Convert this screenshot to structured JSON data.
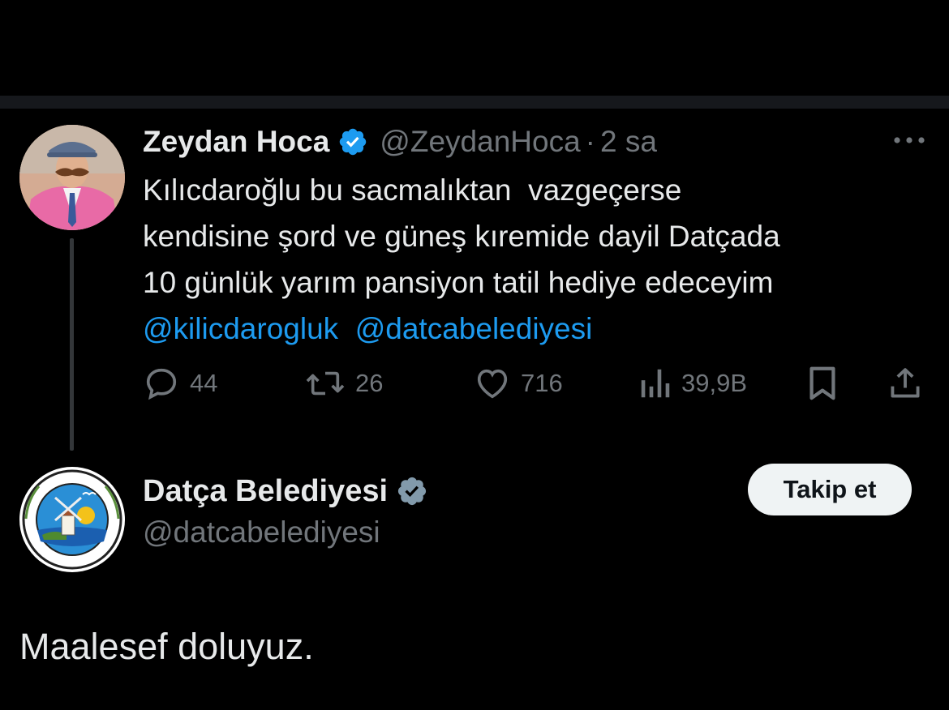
{
  "colors": {
    "background": "#000000",
    "text_primary": "#e7e9ea",
    "text_secondary": "#71767b",
    "accent_link": "#1d9bf0",
    "verified_blue": "#1d9bf0",
    "verified_gray": "#829aab",
    "follow_button_bg": "#eff3f4"
  },
  "tweet": {
    "author": {
      "display_name": "Zeydan Hoca",
      "handle": "@ZeydanHoca",
      "verified_icon": "verified-blue-badge-icon"
    },
    "separator": "·",
    "time": "2 sa",
    "more_icon": "more-horizontal-icon",
    "lines": [
      "Kılıcdaroğlu bu sacmalıktan  vazgeçerse",
      "kendisine şord ve güneş kıremide dayil Datçada",
      "10 günlük yarım pansiyon tatil hediye edeceyim"
    ],
    "mentions": [
      "@kilicdarogluk",
      "@datcabelediyesi"
    ],
    "actions": {
      "reply": {
        "icon": "reply-icon",
        "count": "44"
      },
      "retweet": {
        "icon": "retweet-icon",
        "count": "26"
      },
      "like": {
        "icon": "heart-icon",
        "count": "716"
      },
      "views": {
        "icon": "views-chart-icon",
        "count": "39,9B"
      },
      "bookmark": {
        "icon": "bookmark-icon"
      },
      "share": {
        "icon": "share-icon"
      }
    }
  },
  "reply": {
    "author": {
      "display_name": "Datça Belediyesi",
      "handle": "@datcabelediyesi",
      "verified_icon": "verified-gray-badge-icon"
    },
    "follow_label": "Takip et",
    "text": "Maalesef doluyuz."
  }
}
